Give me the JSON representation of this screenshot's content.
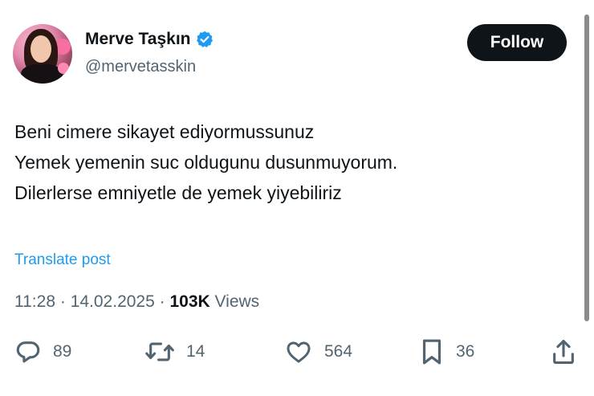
{
  "author": {
    "display_name": "Merve Taşkın",
    "handle": "@mervetasskin",
    "verified": true,
    "verified_color": "#1d9bf0"
  },
  "follow_button": {
    "label": "Follow"
  },
  "tweet": {
    "lines": [
      "Beni cimere sikayet ediyormussunuz",
      "Yemek yemenin suc oldugunu dusunmuyorum.",
      "Dilerlerse emniyetle de yemek yiyebiliriz"
    ],
    "translate_label": "Translate post",
    "time": "11:28",
    "date": "14.02.2025",
    "separator": "·",
    "views_count": "103K",
    "views_label": "Views"
  },
  "actions": {
    "replies": "89",
    "reposts": "14",
    "likes": "564",
    "bookmarks": "36"
  },
  "icons": [
    "verified-badge-icon",
    "reply-icon",
    "repost-icon",
    "like-icon",
    "bookmark-icon",
    "share-icon"
  ],
  "colors": {
    "text": "#0f1419",
    "secondary": "#536471",
    "link": "#1d9bf0",
    "button_bg": "#0f1419"
  }
}
